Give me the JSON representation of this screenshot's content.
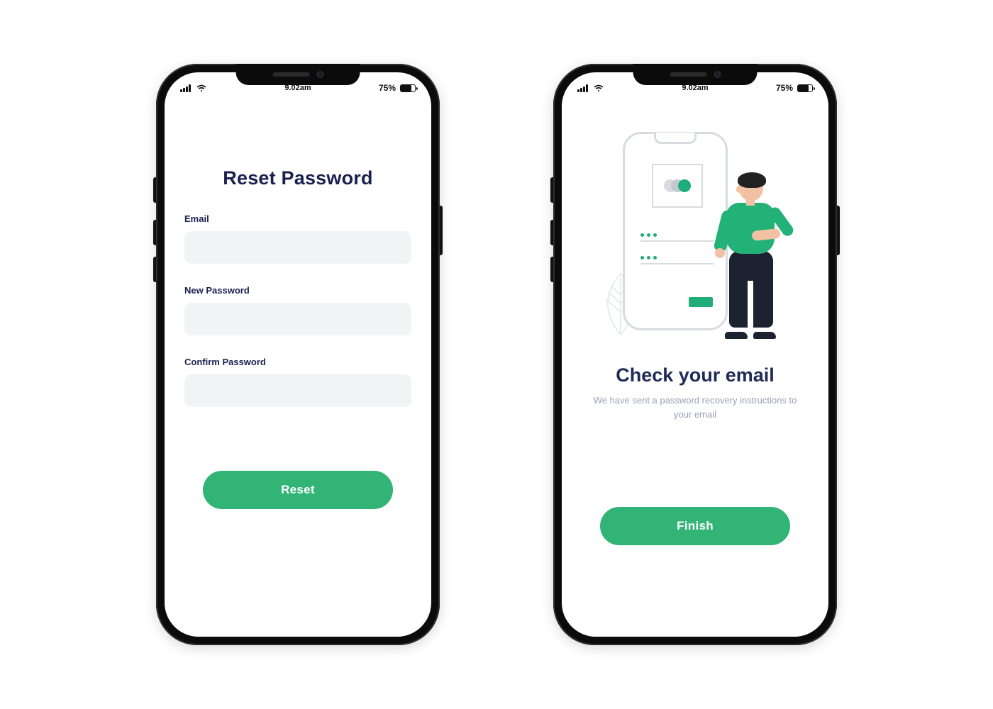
{
  "status": {
    "time": "9.02am",
    "battery_pct": "75%"
  },
  "screen1": {
    "title": "Reset Password",
    "fields": {
      "email_label": "Email",
      "new_pw_label": "New Password",
      "confirm_pw_label": "Confirm Password"
    },
    "button": "Reset"
  },
  "screen2": {
    "title": "Check your email",
    "subtitle": "We have sent a password recovery instructions to your email",
    "button": "Finish"
  },
  "colors": {
    "accent": "#31b476",
    "heading": "#1a2150"
  }
}
